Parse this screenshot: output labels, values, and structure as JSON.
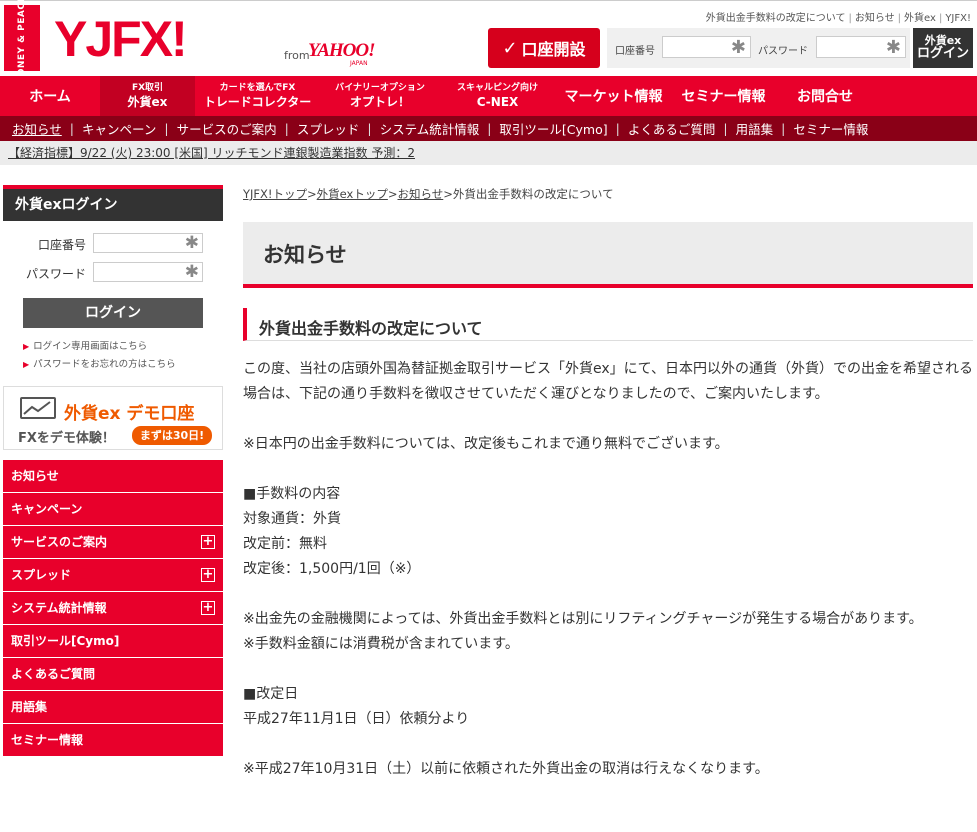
{
  "header": {
    "badge_text": "MONEY & PEACE!",
    "logo": "YJFX!",
    "logo_from": "from",
    "logo_yahoo": "YAHOO!",
    "logo_japan": "JAPAN",
    "top_links": [
      "外貨出金手数料の改定について",
      "お知らせ",
      "外貨ex",
      "YJFX!"
    ],
    "open_account": "口座開設",
    "account_label": "口座番号",
    "password_label": "パスワード",
    "login_small": "外貨ex",
    "login_big": "ログイン"
  },
  "gnav": [
    {
      "small": "",
      "main": "ホーム"
    },
    {
      "small": "FX取引",
      "main": "外貨ex"
    },
    {
      "small": "カードを選んでFX",
      "main": "トレードコレクター"
    },
    {
      "small": "バイナリーオプション",
      "main": "オプトレ！"
    },
    {
      "small": "スキャルピング向け",
      "main": "C-NEX"
    },
    {
      "small": "",
      "main": "マーケット情報"
    },
    {
      "small": "",
      "main": "セミナー情報"
    },
    {
      "small": "",
      "main": "お問合せ"
    }
  ],
  "subnav": [
    "お知らせ",
    "キャンペーン",
    "サービスのご案内",
    "スプレッド",
    "システム統計情報",
    "取引ツール[Cymo]",
    "よくあるご質問",
    "用語集",
    "セミナー情報"
  ],
  "ticker": "【経済指標】9/22 (火) 23:00 [米国] リッチモンド連銀製造業指数 予測：2",
  "side_login": {
    "title": "外貨exログイン",
    "account_label": "口座番号",
    "password_label": "パスワード",
    "button": "ログイン",
    "link1": "ログイン専用画面はこちら",
    "link2": "パスワードをお忘れの方はこちら"
  },
  "demo": {
    "title": "外貨ex デモ口座",
    "sub": "FXをデモ体験！",
    "badge": "まずは30日!"
  },
  "side_menu": [
    {
      "label": "お知らせ",
      "expand": ""
    },
    {
      "label": "キャンペーン",
      "expand": ""
    },
    {
      "label": "サービスのご案内",
      "expand": "+"
    },
    {
      "label": "スプレッド",
      "expand": "+"
    },
    {
      "label": "システム統計情報",
      "expand": "+"
    },
    {
      "label": "取引ツール[Cymo]",
      "expand": ""
    },
    {
      "label": "よくあるご質問",
      "expand": ""
    },
    {
      "label": "用語集",
      "expand": ""
    },
    {
      "label": "セミナー情報",
      "expand": ""
    }
  ],
  "breadcrumb": [
    "YJFX!トップ",
    "外貨exトップ",
    "お知らせ",
    "外貨出金手数料の改定について"
  ],
  "page_title": "お知らせ",
  "section_title": "外貨出金手数料の改定について",
  "body": [
    "この度、当社の店頭外国為替証拠金取引サービス「外貨ex」にて、日本円以外の通貨（外貨）での出金を希望される場合は、下記の通り手数料を徴収させていただく運びとなりましたので、ご案内いたします。",
    "",
    "※日本円の出金手数料については、改定後もこれまで通り無料でございます。",
    "",
    "■手数料の内容",
    "対象通貨：外貨",
    "改定前：無料",
    "改定後：1,500円/1回（※）",
    "",
    "※出金先の金融機関によっては、外貨出金手数料とは別にリフティングチャージが発生する場合があります。",
    "※手数料金額には消費税が含まれています。",
    "",
    "■改定日",
    "平成27年11月1日（日）依頼分より",
    "",
    "※平成27年10月31日（土）以前に依頼された外貨出金の取消は行えなくなります。"
  ]
}
